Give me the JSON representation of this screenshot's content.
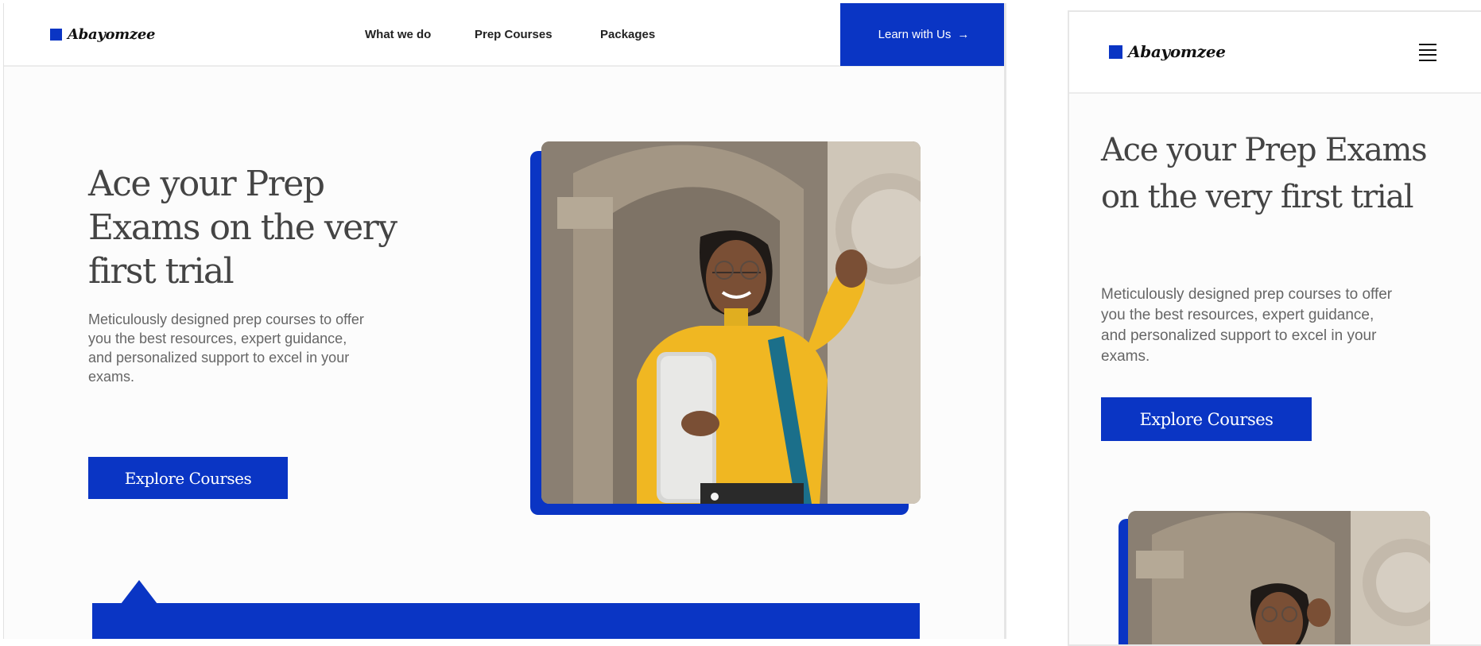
{
  "brand": {
    "name": "Abayomzee",
    "accent_color": "#0a35c4"
  },
  "desktop": {
    "nav": [
      {
        "label": "What we do"
      },
      {
        "label": "Prep Courses"
      },
      {
        "label": "Packages"
      }
    ],
    "cta": {
      "label": "Learn with Us",
      "icon": "arrow-right-icon"
    }
  },
  "mobile": {
    "menu_icon": "hamburger-menu-icon"
  },
  "hero": {
    "title": "Ace your Prep Exams on the very first trial",
    "subtitle": "Meticulously designed prep courses to offer you the best resources, expert guidance, and personalized support to excel in your exams.",
    "button_label": "Explore Courses"
  }
}
